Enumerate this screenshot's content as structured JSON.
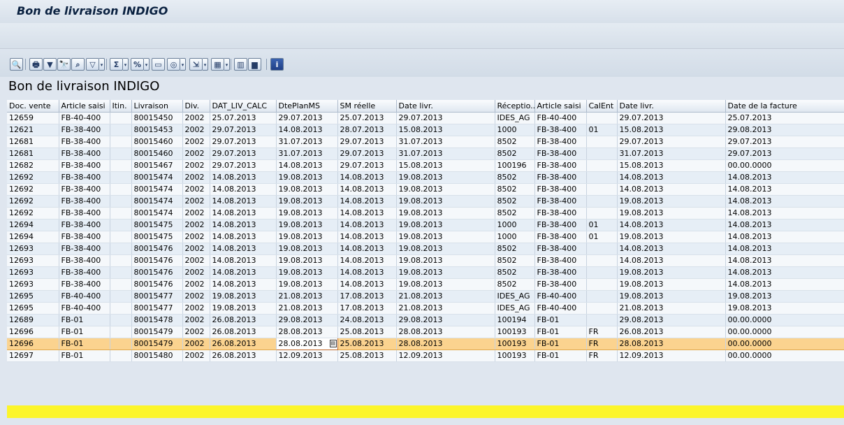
{
  "window": {
    "title": "Bon de livraison INDIGO"
  },
  "toolbar": {
    "buttons": [
      {
        "name": "details-icon",
        "glyph": "🔍"
      },
      {
        "name": "print-icon",
        "glyph": "🖶"
      },
      {
        "name": "filter-icon",
        "glyph": "▼"
      },
      {
        "name": "find-icon",
        "glyph": "🔭"
      },
      {
        "name": "find-next-icon",
        "glyph": "⌕"
      },
      {
        "name": "set-filter-icon",
        "glyph": "▽"
      },
      {
        "name": "total-icon",
        "glyph": "Σ"
      },
      {
        "name": "subtotal-icon",
        "glyph": "%"
      },
      {
        "name": "print-preview-icon",
        "glyph": "▭"
      },
      {
        "name": "views-icon",
        "glyph": "◎"
      },
      {
        "name": "export-icon",
        "glyph": "⇲"
      },
      {
        "name": "choose-layout-icon",
        "glyph": "▦"
      },
      {
        "name": "columns-icon",
        "glyph": "▥"
      },
      {
        "name": "graphic-icon",
        "glyph": "▆"
      },
      {
        "name": "info-icon",
        "glyph": "i"
      }
    ]
  },
  "report": {
    "title": "Bon de livraison INDIGO",
    "columns": [
      "Doc. vente",
      "Article saisi",
      "Itin.",
      "Livraison",
      "Div.",
      "DAT_LIV_CALC",
      "DtePlanMS",
      "SM réelle",
      "Date livr.",
      "Réceptio..",
      "Article saisi",
      "CalEnt",
      "Date livr.",
      "Date de la facture"
    ],
    "rows": [
      [
        "12659",
        "FB-40-400",
        "",
        "80015450",
        "2002",
        "25.07.2013",
        "29.07.2013",
        "25.07.2013",
        "29.07.2013",
        "IDES_AG",
        "FB-40-400",
        "",
        "29.07.2013",
        "25.07.2013"
      ],
      [
        "12621",
        "FB-38-400",
        "",
        "80015453",
        "2002",
        "29.07.2013",
        "14.08.2013",
        "28.07.2013",
        "15.08.2013",
        "1000",
        "FB-38-400",
        "01",
        "15.08.2013",
        "29.08.2013"
      ],
      [
        "12681",
        "FB-38-400",
        "",
        "80015460",
        "2002",
        "29.07.2013",
        "31.07.2013",
        "29.07.2013",
        "31.07.2013",
        "8502",
        "FB-38-400",
        "",
        "29.07.2013",
        "29.07.2013"
      ],
      [
        "12681",
        "FB-38-400",
        "",
        "80015460",
        "2002",
        "29.07.2013",
        "31.07.2013",
        "29.07.2013",
        "31.07.2013",
        "8502",
        "FB-38-400",
        "",
        "31.07.2013",
        "29.07.2013"
      ],
      [
        "12682",
        "FB-38-400",
        "",
        "80015467",
        "2002",
        "29.07.2013",
        "14.08.2013",
        "29.07.2013",
        "15.08.2013",
        "100196",
        "FB-38-400",
        "",
        "15.08.2013",
        "00.00.0000"
      ],
      [
        "12692",
        "FB-38-400",
        "",
        "80015474",
        "2002",
        "14.08.2013",
        "19.08.2013",
        "14.08.2013",
        "19.08.2013",
        "8502",
        "FB-38-400",
        "",
        "14.08.2013",
        "14.08.2013"
      ],
      [
        "12692",
        "FB-38-400",
        "",
        "80015474",
        "2002",
        "14.08.2013",
        "19.08.2013",
        "14.08.2013",
        "19.08.2013",
        "8502",
        "FB-38-400",
        "",
        "14.08.2013",
        "14.08.2013"
      ],
      [
        "12692",
        "FB-38-400",
        "",
        "80015474",
        "2002",
        "14.08.2013",
        "19.08.2013",
        "14.08.2013",
        "19.08.2013",
        "8502",
        "FB-38-400",
        "",
        "19.08.2013",
        "14.08.2013"
      ],
      [
        "12692",
        "FB-38-400",
        "",
        "80015474",
        "2002",
        "14.08.2013",
        "19.08.2013",
        "14.08.2013",
        "19.08.2013",
        "8502",
        "FB-38-400",
        "",
        "19.08.2013",
        "14.08.2013"
      ],
      [
        "12694",
        "FB-38-400",
        "",
        "80015475",
        "2002",
        "14.08.2013",
        "19.08.2013",
        "14.08.2013",
        "19.08.2013",
        "1000",
        "FB-38-400",
        "01",
        "14.08.2013",
        "14.08.2013"
      ],
      [
        "12694",
        "FB-38-400",
        "",
        "80015475",
        "2002",
        "14.08.2013",
        "19.08.2013",
        "14.08.2013",
        "19.08.2013",
        "1000",
        "FB-38-400",
        "01",
        "19.08.2013",
        "14.08.2013"
      ],
      [
        "12693",
        "FB-38-400",
        "",
        "80015476",
        "2002",
        "14.08.2013",
        "19.08.2013",
        "14.08.2013",
        "19.08.2013",
        "8502",
        "FB-38-400",
        "",
        "14.08.2013",
        "14.08.2013"
      ],
      [
        "12693",
        "FB-38-400",
        "",
        "80015476",
        "2002",
        "14.08.2013",
        "19.08.2013",
        "14.08.2013",
        "19.08.2013",
        "8502",
        "FB-38-400",
        "",
        "14.08.2013",
        "14.08.2013"
      ],
      [
        "12693",
        "FB-38-400",
        "",
        "80015476",
        "2002",
        "14.08.2013",
        "19.08.2013",
        "14.08.2013",
        "19.08.2013",
        "8502",
        "FB-38-400",
        "",
        "19.08.2013",
        "14.08.2013"
      ],
      [
        "12693",
        "FB-38-400",
        "",
        "80015476",
        "2002",
        "14.08.2013",
        "19.08.2013",
        "14.08.2013",
        "19.08.2013",
        "8502",
        "FB-38-400",
        "",
        "19.08.2013",
        "14.08.2013"
      ],
      [
        "12695",
        "FB-40-400",
        "",
        "80015477",
        "2002",
        "19.08.2013",
        "21.08.2013",
        "17.08.2013",
        "21.08.2013",
        "IDES_AG",
        "FB-40-400",
        "",
        "19.08.2013",
        "19.08.2013"
      ],
      [
        "12695",
        "FB-40-400",
        "",
        "80015477",
        "2002",
        "19.08.2013",
        "21.08.2013",
        "17.08.2013",
        "21.08.2013",
        "IDES_AG",
        "FB-40-400",
        "",
        "21.08.2013",
        "19.08.2013"
      ],
      [
        "12689",
        "FB-01",
        "",
        "80015478",
        "2002",
        "26.08.2013",
        "29.08.2013",
        "24.08.2013",
        "29.08.2013",
        "100194",
        "FB-01",
        "",
        "29.08.2013",
        "00.00.0000"
      ],
      [
        "12696",
        "FB-01",
        "",
        "80015479",
        "2002",
        "26.08.2013",
        "28.08.2013",
        "25.08.2013",
        "28.08.2013",
        "100193",
        "FB-01",
        "FR",
        "26.08.2013",
        "00.00.0000"
      ],
      [
        "12696",
        "FB-01",
        "",
        "80015479",
        "2002",
        "26.08.2013",
        "28.08.2013",
        "25.08.2013",
        "28.08.2013",
        "100193",
        "FB-01",
        "FR",
        "28.08.2013",
        "00.00.0000"
      ],
      [
        "12697",
        "FB-01",
        "",
        "80015480",
        "2002",
        "26.08.2013",
        "12.09.2013",
        "25.08.2013",
        "12.09.2013",
        "100193",
        "FB-01",
        "FR",
        "12.09.2013",
        "00.00.0000"
      ]
    ],
    "selected_row": 19,
    "editing_cell": {
      "row": 19,
      "col": 6
    }
  }
}
